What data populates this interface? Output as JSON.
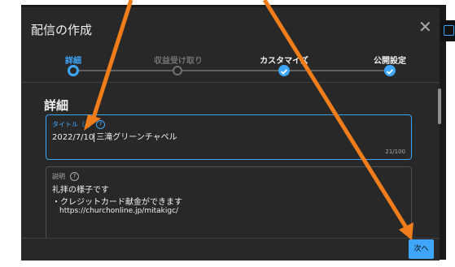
{
  "dialog": {
    "title": "配信の作成",
    "close_glyph": "✕",
    "next_label": "次へ"
  },
  "steps": [
    {
      "label": "詳細",
      "state": "current"
    },
    {
      "label": "収益受け取り",
      "state": "pending"
    },
    {
      "label": "カスタマイズ",
      "state": "done"
    },
    {
      "label": "公開設定",
      "state": "done"
    }
  ],
  "section": {
    "heading": "詳細"
  },
  "title_field": {
    "label": "タイトル（必",
    "value_before_caret": "2022/7/10",
    "value_after_caret": "三滝グリーンチャペル",
    "counter": "21/100"
  },
  "description_field": {
    "label": "説明",
    "lines": [
      "礼拝の様子です",
      "・クレジットカード献金ができます",
      "https://churchonline.jp/mitakigc/"
    ]
  },
  "colors": {
    "accent": "#3ea6ff",
    "annotation_arrow": "#f07d1a",
    "dialog_bg": "#282828",
    "pending": "#717171"
  },
  "icons": [
    "close-icon",
    "help-icon",
    "check-icon",
    "window-icon"
  ]
}
